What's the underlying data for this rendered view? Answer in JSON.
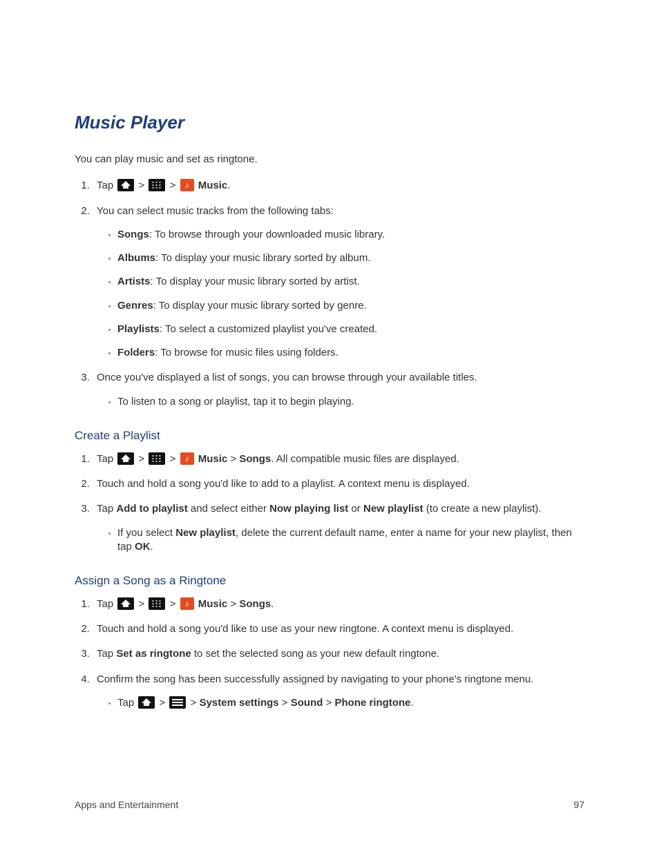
{
  "title": "Music Player",
  "intro": "You can play music and set as ringtone.",
  "sep": ">",
  "tap": "Tap ",
  "nav_end_music": "Music",
  "steps1": {
    "s1_tail": ".",
    "s2": "You can select music tracks from the following tabs:",
    "tabs": [
      {
        "name": "Songs",
        "desc": ": To browse through your downloaded music library."
      },
      {
        "name": "Albums",
        "desc": ": To display your music library sorted by album."
      },
      {
        "name": "Artists",
        "desc": ": To display your music library sorted by artist."
      },
      {
        "name": "Genres",
        "desc": ": To display your music library sorted by genre."
      },
      {
        "name": "Playlists",
        "desc": ": To select a customized playlist you've created."
      },
      {
        "name": "Folders",
        "desc": ": To browse for music files using folders."
      }
    ],
    "s3": "Once you've displayed a list of songs, you can browse through your available titles.",
    "s3_b1": "To listen to a song or playlist, tap it to begin playing."
  },
  "create": {
    "heading": "Create a Playlist",
    "s1_songs": "Songs",
    "s1_tail": ". All compatible music files are displayed.",
    "s2": "Touch and hold a song you'd like to add to a playlist. A context menu is displayed.",
    "s3_pre": "Tap ",
    "s3_b1": "Add to playlist",
    "s3_mid1": " and select either ",
    "s3_b2": "Now playing list",
    "s3_mid2": " or ",
    "s3_b3": "New playlist",
    "s3_tail": " (to create a new playlist).",
    "s3_sub_pre": "If you select ",
    "s3_sub_b1": "New playlist",
    "s3_sub_mid": ", delete the current default name, enter a name for your new playlist, then tap ",
    "s3_sub_b2": "OK",
    "s3_sub_tail": "."
  },
  "assign": {
    "heading": "Assign a Song as a Ringtone",
    "s1_songs": "Songs",
    "s1_tail": ".",
    "s2": "Touch and hold a song you'd like to use as your new ringtone. A context menu is displayed.",
    "s3_pre": "Tap ",
    "s3_b1": "Set as ringtone",
    "s3_tail": " to set the selected song as your new default ringtone.",
    "s4": "Confirm the song has been successfully assigned by navigating to your phone's ringtone menu.",
    "s4_sub_pre": "Tap ",
    "s4_sub_b1": "System settings",
    "s4_sub_b2": "Sound",
    "s4_sub_b3": "Phone ringtone",
    "s4_sub_tail": "."
  },
  "footer": {
    "left": "Apps and Entertainment",
    "right": "97"
  }
}
